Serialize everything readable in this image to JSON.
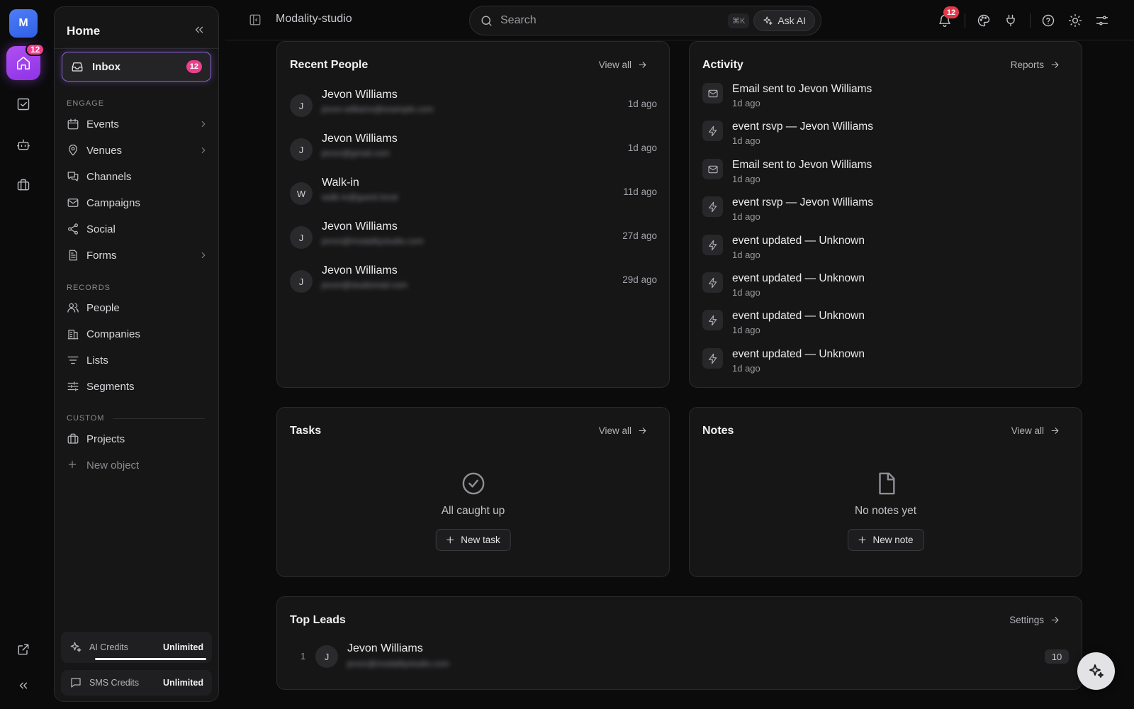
{
  "rail": {
    "avatar_letter": "M",
    "home_badge": "12"
  },
  "sidebar": {
    "title": "Home",
    "inbox": {
      "label": "Inbox",
      "badge": "12"
    },
    "sections": {
      "engage": "ENGAGE",
      "records": "RECORDS",
      "custom": "CUSTOM"
    },
    "engage_items": [
      "Events",
      "Venues",
      "Channels",
      "Campaigns",
      "Social",
      "Forms"
    ],
    "records_items": [
      "People",
      "Companies",
      "Lists",
      "Segments"
    ],
    "custom_items": [
      "Projects"
    ],
    "new_object": "New object",
    "ai_credits": {
      "label": "AI Credits",
      "value": "Unlimited"
    },
    "sms_credits": {
      "label": "SMS Credits",
      "value": "Unlimited"
    }
  },
  "topbar": {
    "workspace": "Modality-studio",
    "search_placeholder": "Search",
    "shortcut": "⌘K",
    "ask_ai": "Ask AI",
    "notif_badge": "12"
  },
  "recent_people": {
    "title": "Recent People",
    "link": "View all",
    "items": [
      {
        "initial": "J",
        "name": "Jevon Williams",
        "email": "jevon.williams@example.com",
        "time": "1d ago"
      },
      {
        "initial": "J",
        "name": "Jevon Williams",
        "email": "jevon@gmail.com",
        "time": "1d ago"
      },
      {
        "initial": "W",
        "name": "Walk-in",
        "email": "walk-in@guest.local",
        "time": "11d ago"
      },
      {
        "initial": "J",
        "name": "Jevon Williams",
        "email": "jevon@modalitystudio.com",
        "time": "27d ago"
      },
      {
        "initial": "J",
        "name": "Jevon Williams",
        "email": "jevon@studiomail.com",
        "time": "29d ago"
      }
    ]
  },
  "activity": {
    "title": "Activity",
    "link": "Reports",
    "items": [
      {
        "icon": "mail-icon",
        "text": "Email sent to Jevon Williams",
        "time": "1d ago"
      },
      {
        "icon": "bolt-icon",
        "text": "event rsvp — Jevon Williams",
        "time": "1d ago"
      },
      {
        "icon": "mail-icon",
        "text": "Email sent to Jevon Williams",
        "time": "1d ago"
      },
      {
        "icon": "bolt-icon",
        "text": "event rsvp — Jevon Williams",
        "time": "1d ago"
      },
      {
        "icon": "bolt-icon",
        "text": "event updated — Unknown",
        "time": "1d ago"
      },
      {
        "icon": "bolt-icon",
        "text": "event updated — Unknown",
        "time": "1d ago"
      },
      {
        "icon": "bolt-icon",
        "text": "event updated — Unknown",
        "time": "1d ago"
      },
      {
        "icon": "bolt-icon",
        "text": "event updated — Unknown",
        "time": "1d ago"
      }
    ]
  },
  "tasks": {
    "title": "Tasks",
    "link": "View all",
    "empty_text": "All caught up",
    "button": "New task"
  },
  "notes": {
    "title": "Notes",
    "link": "View all",
    "empty_text": "No notes yet",
    "button": "New note"
  },
  "top_leads": {
    "title": "Top Leads",
    "link": "Settings",
    "items": [
      {
        "rank": "1",
        "initial": "J",
        "name": "Jevon Williams",
        "email": "jevon@modalitystudio.com",
        "score": "10"
      }
    ]
  },
  "colors": {
    "accent_purple": "#a855f7",
    "badge_pink": "#ec3f8c",
    "brand_blue": "#3b6ef0"
  }
}
